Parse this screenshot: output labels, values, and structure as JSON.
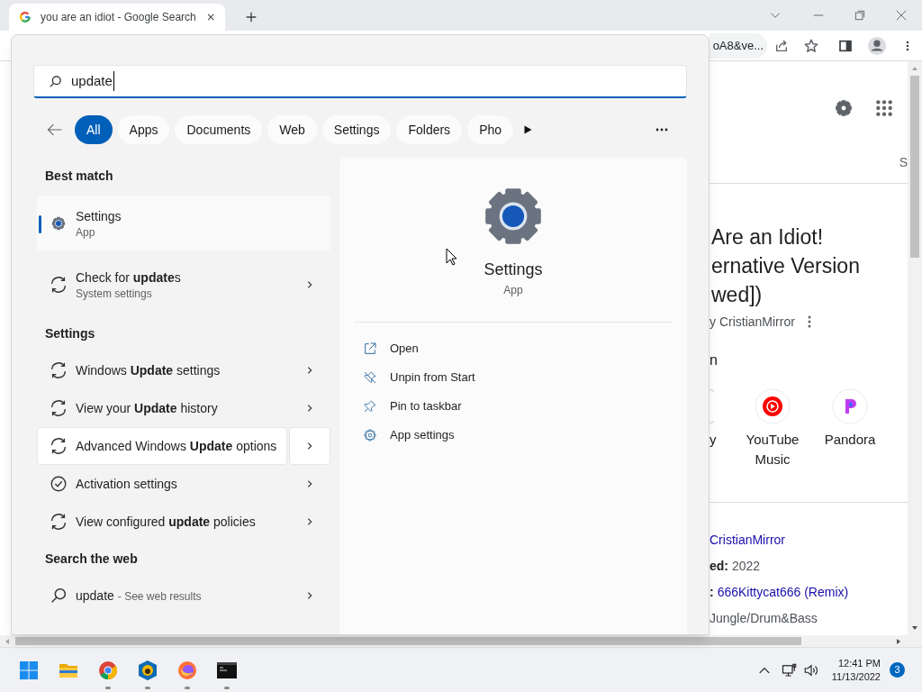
{
  "browser": {
    "tab": {
      "title": "you are an idiot - Google Search"
    },
    "address_fragment": "oA8&ve..."
  },
  "search": {
    "query": "update",
    "filters": [
      {
        "label": "All",
        "selected": true
      },
      {
        "label": "Apps",
        "selected": false
      },
      {
        "label": "Documents",
        "selected": false
      },
      {
        "label": "Web",
        "selected": false
      },
      {
        "label": "Settings",
        "selected": false
      },
      {
        "label": "Folders",
        "selected": false
      },
      {
        "label": "Pho",
        "selected": false
      }
    ],
    "sections": [
      {
        "heading": "Best match",
        "items": [
          {
            "kind": "settings-app",
            "title": "Settings",
            "subtitle": "App",
            "chevron": false,
            "selected": true,
            "hovered": false
          },
          {
            "kind": "sync",
            "title": "Check for **update**s",
            "subtitle": "System settings",
            "chevron": true,
            "selected": false,
            "hovered": false
          }
        ]
      },
      {
        "heading": "Settings",
        "items": [
          {
            "kind": "sync",
            "title": "Windows **Update** settings",
            "chevron": true,
            "selected": false,
            "hovered": false
          },
          {
            "kind": "sync",
            "title": "View your **Update** history",
            "chevron": true,
            "selected": false,
            "hovered": false
          },
          {
            "kind": "sync",
            "title": "Advanced Windows **Update** options",
            "chevron": true,
            "selected": false,
            "hovered": true
          },
          {
            "kind": "check-circle",
            "title": "Activation settings",
            "chevron": true,
            "selected": false,
            "hovered": false
          },
          {
            "kind": "sync",
            "title": "View configured **update** policies",
            "chevron": true,
            "selected": false,
            "hovered": false
          }
        ]
      },
      {
        "heading": "Search the web",
        "items": [
          {
            "kind": "search",
            "title": "update",
            "note": "- See web results",
            "chevron": true,
            "selected": false,
            "hovered": false
          }
        ]
      }
    ],
    "preview": {
      "title": "Settings",
      "subtitle": "App",
      "actions": [
        {
          "kind": "open",
          "label": "Open"
        },
        {
          "kind": "unpin",
          "label": "Unpin from Start"
        },
        {
          "kind": "pin",
          "label": "Pin to taskbar"
        },
        {
          "kind": "gear",
          "label": "App settings"
        }
      ]
    }
  },
  "page": {
    "tab_fragment": "S",
    "title_lines": [
      "Are an Idiot!",
      "ernative Version",
      "wed])"
    ],
    "byline": "y CristianMirror",
    "section_heading": "n",
    "services": [
      {
        "kind": "partial",
        "label": "y"
      },
      {
        "kind": "youtube-music",
        "label": "YouTube Music"
      },
      {
        "kind": "pandora",
        "label": "Pandora"
      }
    ],
    "facts": [
      {
        "value": "CristianMirror",
        "link": true
      },
      {
        "label": "ed:",
        "value": "2022",
        "link": false
      },
      {
        "label": ":",
        "value": "666Kittycat666 (Remix)",
        "link": true
      },
      {
        "value": "Jungle/Drum&Bass",
        "link": false
      }
    ]
  },
  "taskbar": {
    "apps": [
      {
        "kind": "start",
        "running": false
      },
      {
        "kind": "folder",
        "running": false
      },
      {
        "kind": "chrome",
        "running": true
      },
      {
        "kind": "lion",
        "running": true
      },
      {
        "kind": "firefox",
        "running": true
      },
      {
        "kind": "terminal",
        "running": true
      }
    ],
    "time": "12:41 PM",
    "date": "11/13/2022",
    "notifications": "3"
  }
}
